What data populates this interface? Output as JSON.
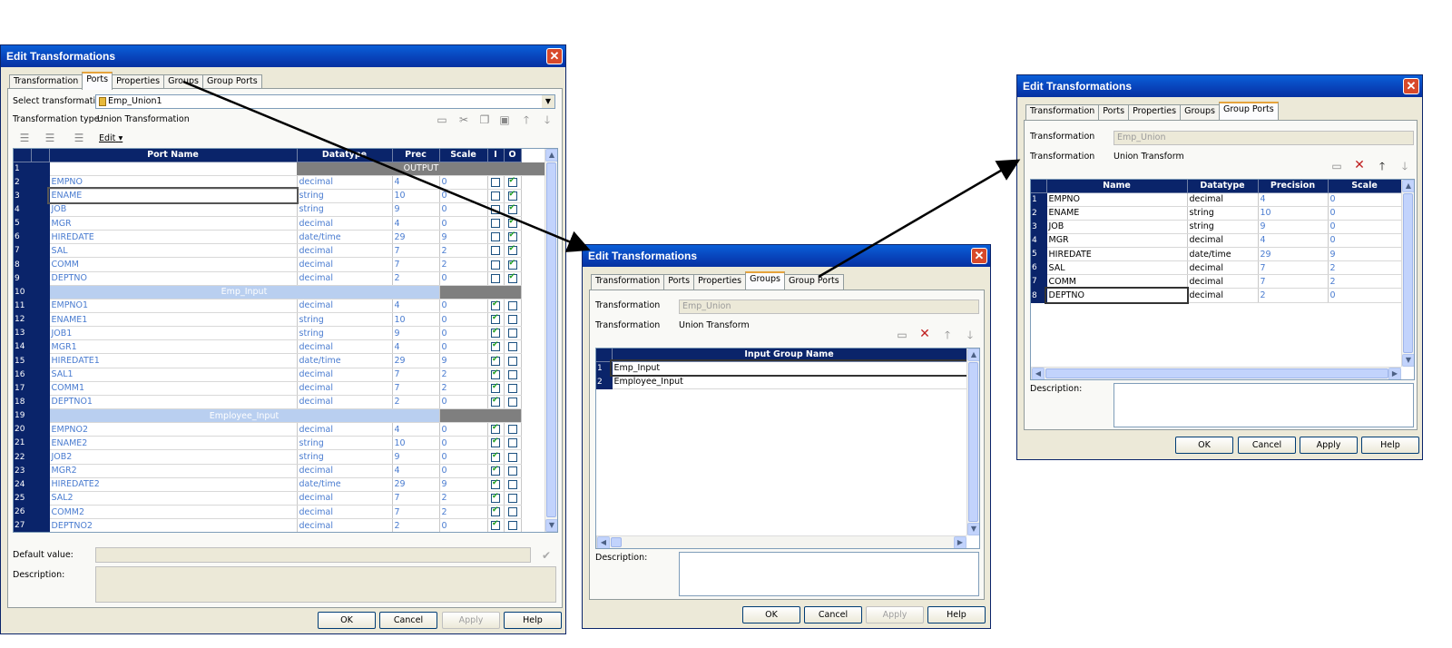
{
  "window1": {
    "title": "Edit Transformations",
    "tabs": [
      "Transformation",
      "Ports",
      "Properties",
      "Groups",
      "Group Ports"
    ],
    "selected_tab": "Ports",
    "select_label": "Select transformation:",
    "select_value": "Emp_Union1",
    "type_label": "Transformation type:",
    "type_value": "Union Transformation",
    "edit_menu": "Edit",
    "columns": [
      "Port Name",
      "Datatype",
      "Prec",
      "Scale",
      "I",
      "O"
    ],
    "output_label": "OUTPUT",
    "rows": [
      {
        "n": "1",
        "kind": "header"
      },
      {
        "n": "2",
        "name": "EMPNO",
        "type": "decimal",
        "prec": "4",
        "scale": "0",
        "i": false,
        "o": true
      },
      {
        "n": "3",
        "name": "ENAME",
        "type": "string",
        "prec": "10",
        "scale": "0",
        "i": false,
        "o": true
      },
      {
        "n": "4",
        "name": "JOB",
        "type": "string",
        "prec": "9",
        "scale": "0",
        "i": false,
        "o": true
      },
      {
        "n": "5",
        "name": "MGR",
        "type": "decimal",
        "prec": "4",
        "scale": "0",
        "i": false,
        "o": true
      },
      {
        "n": "6",
        "name": "HIREDATE",
        "type": "date/time",
        "prec": "29",
        "scale": "9",
        "i": false,
        "o": true
      },
      {
        "n": "7",
        "name": "SAL",
        "type": "decimal",
        "prec": "7",
        "scale": "2",
        "i": false,
        "o": true
      },
      {
        "n": "8",
        "name": "COMM",
        "type": "decimal",
        "prec": "7",
        "scale": "2",
        "i": false,
        "o": true
      },
      {
        "n": "9",
        "name": "DEPTNO",
        "type": "decimal",
        "prec": "2",
        "scale": "0",
        "i": false,
        "o": true
      },
      {
        "n": "10",
        "kind": "group",
        "name": "Emp_Input"
      },
      {
        "n": "11",
        "name": "EMPNO1",
        "type": "decimal",
        "prec": "4",
        "scale": "0",
        "i": true,
        "o": false
      },
      {
        "n": "12",
        "name": "ENAME1",
        "type": "string",
        "prec": "10",
        "scale": "0",
        "i": true,
        "o": false
      },
      {
        "n": "13",
        "name": "JOB1",
        "type": "string",
        "prec": "9",
        "scale": "0",
        "i": true,
        "o": false
      },
      {
        "n": "14",
        "name": "MGR1",
        "type": "decimal",
        "prec": "4",
        "scale": "0",
        "i": true,
        "o": false
      },
      {
        "n": "15",
        "name": "HIREDATE1",
        "type": "date/time",
        "prec": "29",
        "scale": "9",
        "i": true,
        "o": false
      },
      {
        "n": "16",
        "name": "SAL1",
        "type": "decimal",
        "prec": "7",
        "scale": "2",
        "i": true,
        "o": false
      },
      {
        "n": "17",
        "name": "COMM1",
        "type": "decimal",
        "prec": "7",
        "scale": "2",
        "i": true,
        "o": false
      },
      {
        "n": "18",
        "name": "DEPTNO1",
        "type": "decimal",
        "prec": "2",
        "scale": "0",
        "i": true,
        "o": false
      },
      {
        "n": "19",
        "kind": "group",
        "name": "Employee_Input"
      },
      {
        "n": "20",
        "name": "EMPNO2",
        "type": "decimal",
        "prec": "4",
        "scale": "0",
        "i": true,
        "o": false
      },
      {
        "n": "21",
        "name": "ENAME2",
        "type": "string",
        "prec": "10",
        "scale": "0",
        "i": true,
        "o": false
      },
      {
        "n": "22",
        "name": "JOB2",
        "type": "string",
        "prec": "9",
        "scale": "0",
        "i": true,
        "o": false
      },
      {
        "n": "23",
        "name": "MGR2",
        "type": "decimal",
        "prec": "4",
        "scale": "0",
        "i": true,
        "o": false
      },
      {
        "n": "24",
        "name": "HIREDATE2",
        "type": "date/time",
        "prec": "29",
        "scale": "9",
        "i": true,
        "o": false
      },
      {
        "n": "25",
        "name": "SAL2",
        "type": "decimal",
        "prec": "7",
        "scale": "2",
        "i": true,
        "o": false
      },
      {
        "n": "26",
        "name": "COMM2",
        "type": "decimal",
        "prec": "7",
        "scale": "2",
        "i": true,
        "o": false
      },
      {
        "n": "27",
        "name": "DEPTNO2",
        "type": "decimal",
        "prec": "2",
        "scale": "0",
        "i": true,
        "o": false
      }
    ],
    "default_label": "Default value:",
    "description_label": "Description:",
    "buttons": [
      "OK",
      "Cancel",
      "Apply",
      "Help"
    ]
  },
  "window2": {
    "title": "Edit Transformations",
    "tabs": [
      "Transformation",
      "Ports",
      "Properties",
      "Groups",
      "Group Ports"
    ],
    "selected_tab": "Groups",
    "transformation_label": "Transformation",
    "transformation_value": "Emp_Union",
    "type_label": "Transformation",
    "type_value": "Union Transform",
    "column": "Input Group Name",
    "rows": [
      {
        "n": "1",
        "name": "Emp_Input"
      },
      {
        "n": "2",
        "name": "Employee_Input"
      }
    ],
    "description_label": "Description:",
    "buttons": [
      "OK",
      "Cancel",
      "Apply",
      "Help"
    ]
  },
  "window3": {
    "title": "Edit Transformations",
    "tabs": [
      "Transformation",
      "Ports",
      "Properties",
      "Groups",
      "Group Ports"
    ],
    "selected_tab": "Group Ports",
    "transformation_label": "Transformation",
    "transformation_value": "Emp_Union",
    "type_label": "Transformation",
    "type_value": "Union Transform",
    "columns": [
      "Name",
      "Datatype",
      "Precision",
      "Scale"
    ],
    "rows": [
      {
        "n": "1",
        "name": "EMPNO",
        "type": "decimal",
        "prec": "4",
        "scale": "0"
      },
      {
        "n": "2",
        "name": "ENAME",
        "type": "string",
        "prec": "10",
        "scale": "0"
      },
      {
        "n": "3",
        "name": "JOB",
        "type": "string",
        "prec": "9",
        "scale": "0"
      },
      {
        "n": "4",
        "name": "MGR",
        "type": "decimal",
        "prec": "4",
        "scale": "0"
      },
      {
        "n": "5",
        "name": "HIREDATE",
        "type": "date/time",
        "prec": "29",
        "scale": "9"
      },
      {
        "n": "6",
        "name": "SAL",
        "type": "decimal",
        "prec": "7",
        "scale": "2"
      },
      {
        "n": "7",
        "name": "COMM",
        "type": "decimal",
        "prec": "7",
        "scale": "2"
      },
      {
        "n": "8",
        "name": "DEPTNO",
        "type": "decimal",
        "prec": "2",
        "scale": "0"
      }
    ],
    "description_label": "Description:",
    "buttons": [
      "OK",
      "Cancel",
      "Apply",
      "Help"
    ]
  }
}
